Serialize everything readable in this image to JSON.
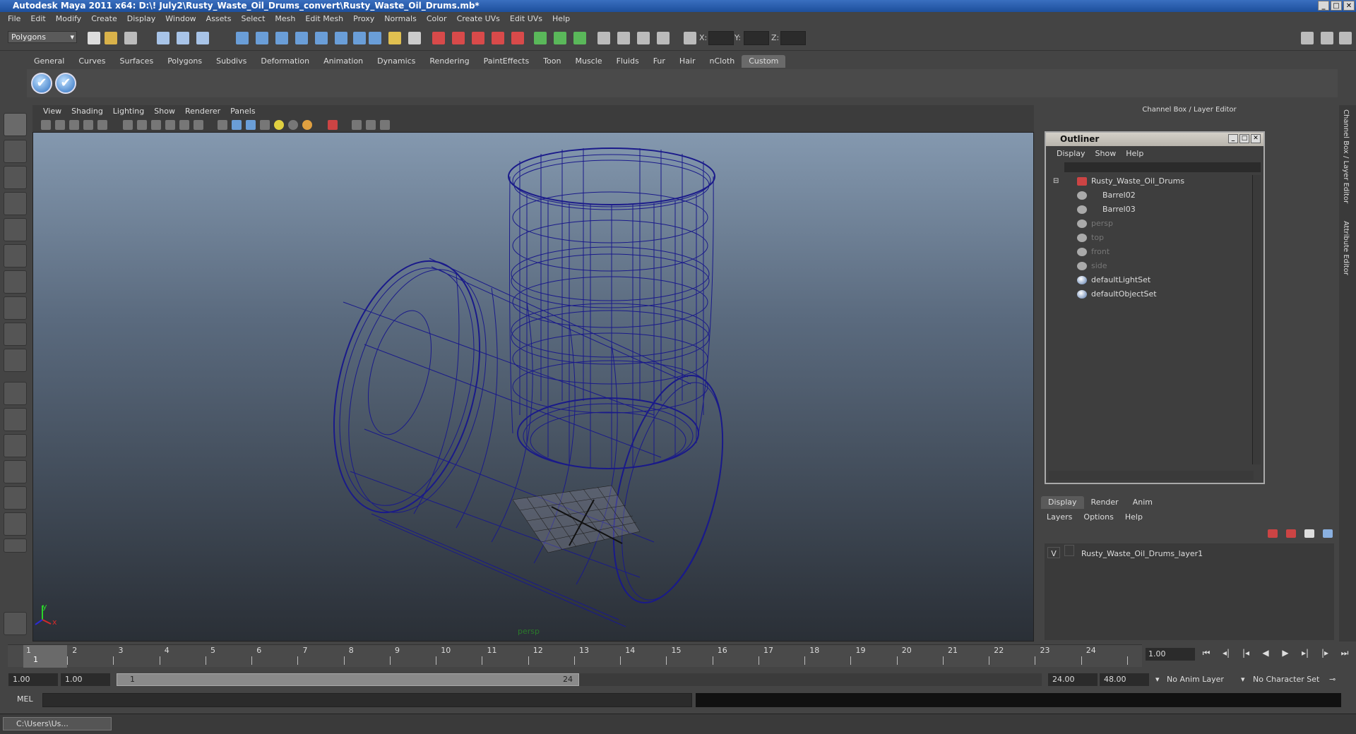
{
  "window": {
    "title": "Autodesk Maya 2011 x64: D:\\! July2\\Rusty_Waste_Oil_Drums_convert\\Rusty_Waste_Oil_Drums.mb*",
    "controls": [
      "_",
      "□",
      "✕"
    ]
  },
  "menubar": [
    "File",
    "Edit",
    "Modify",
    "Create",
    "Display",
    "Window",
    "Assets",
    "Select",
    "Mesh",
    "Edit Mesh",
    "Proxy",
    "Normals",
    "Color",
    "Create UVs",
    "Edit UVs",
    "Help"
  ],
  "toolbar": {
    "mode": "Polygons",
    "x_label": "X:",
    "y_label": "Y:",
    "z_label": "Z:"
  },
  "shelf": {
    "tabs": [
      "General",
      "Curves",
      "Surfaces",
      "Polygons",
      "Subdivs",
      "Deformation",
      "Animation",
      "Dynamics",
      "Rendering",
      "PaintEffects",
      "Toon",
      "Muscle",
      "Fluids",
      "Fur",
      "Hair",
      "nCloth",
      "Custom"
    ],
    "active_tab": "Custom"
  },
  "viewport": {
    "menu": [
      "View",
      "Shading",
      "Lighting",
      "Show",
      "Renderer",
      "Panels"
    ],
    "camera": "persp",
    "axis_y": "y",
    "axis_x": "x",
    "wire_color": "#1a1a8a"
  },
  "channel_box": {
    "title": "Channel Box / Layer Editor"
  },
  "outliner": {
    "title": "Outliner",
    "menu": [
      "Display",
      "Show",
      "Help"
    ],
    "items": [
      {
        "label": "Rusty_Waste_Oil_Drums",
        "type": "group",
        "dim": false
      },
      {
        "label": "Barrel02",
        "type": "mesh",
        "dim": false
      },
      {
        "label": "Barrel03",
        "type": "mesh",
        "dim": false
      },
      {
        "label": "persp",
        "type": "camera",
        "dim": true
      },
      {
        "label": "top",
        "type": "camera",
        "dim": true
      },
      {
        "label": "front",
        "type": "camera",
        "dim": true
      },
      {
        "label": "side",
        "type": "camera",
        "dim": true
      },
      {
        "label": "defaultLightSet",
        "type": "set",
        "dim": false
      },
      {
        "label": "defaultObjectSet",
        "type": "set",
        "dim": false
      }
    ]
  },
  "layer_editor": {
    "tabs": [
      "Display",
      "Render",
      "Anim"
    ],
    "active_tab": "Display",
    "menu": [
      "Layers",
      "Options",
      "Help"
    ],
    "layer": {
      "visible": "V",
      "name": "Rusty_Waste_Oil_Drums_layer1"
    }
  },
  "side_tabs": [
    "Channel Box / Layer Editor",
    "Attribute Editor"
  ],
  "timeline": {
    "ticks": [
      "1",
      "2",
      "3",
      "4",
      "5",
      "6",
      "7",
      "8",
      "9",
      "10",
      "11",
      "12",
      "13",
      "14",
      "15",
      "16",
      "17",
      "18",
      "19",
      "20",
      "21",
      "22",
      "23",
      "24"
    ],
    "current_frame": "1",
    "current_time": "1.00"
  },
  "range": {
    "start": "1.00",
    "playback_start": "1.00",
    "slider_start": "1",
    "slider_end": "24",
    "playback_end": "24.00",
    "end": "48.00",
    "anim_layer": "No Anim Layer",
    "character_set": "No Character Set"
  },
  "command_line": {
    "label": "MEL"
  },
  "taskbar": {
    "item": "C:\\Users\\Us..."
  }
}
